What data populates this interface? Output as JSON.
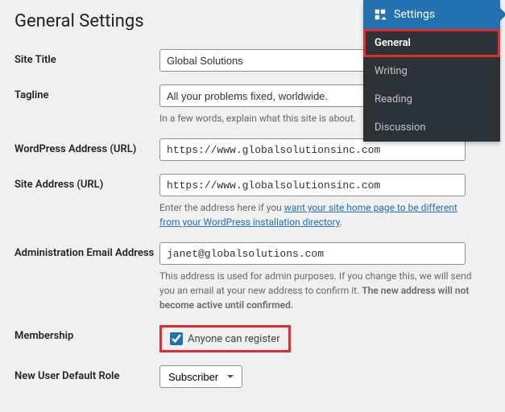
{
  "page": {
    "title": "General Settings"
  },
  "fields": {
    "site_title": {
      "label": "Site Title",
      "value": "Global Solutions"
    },
    "tagline": {
      "label": "Tagline",
      "value": "All your problems fixed, worldwide.",
      "description": "In a few words, explain what this site is about."
    },
    "wp_address": {
      "label": "WordPress Address (URL)",
      "value": "https://www.globalsolutionsinc.com"
    },
    "site_address": {
      "label": "Site Address (URL)",
      "value": "https://www.globalsolutionsinc.com",
      "description_pre": "Enter the address here if you ",
      "description_link": "want your site home page to be different from your WordPress installation directory",
      "description_post": "."
    },
    "admin_email": {
      "label": "Administration Email Address",
      "value": "janet@globalsolutions.com",
      "description_pre": "This address is used for admin purposes. If you change this, we will send you an email at your new address to confirm it. ",
      "description_strong": "The new address will not become active until confirmed."
    },
    "membership": {
      "label": "Membership",
      "checkbox_label": "Anyone can register"
    },
    "default_role": {
      "label": "New User Default Role",
      "value": "Subscriber"
    }
  },
  "flyout": {
    "header": "Settings",
    "items": [
      "General",
      "Writing",
      "Reading",
      "Discussion"
    ]
  }
}
